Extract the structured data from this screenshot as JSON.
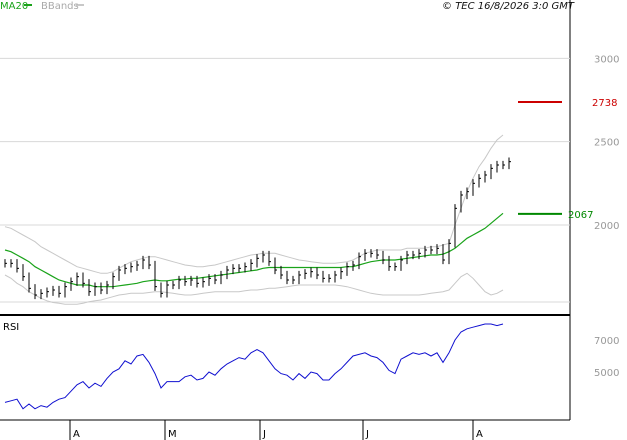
{
  "header": {
    "ma_label": "MA20",
    "bands_label": "BBands",
    "copyright": "© TEC 16/8/2026 3:0 GMT"
  },
  "colors": {
    "ma": "#1aa31a",
    "bands": "#c8c8c8",
    "price": "#000000",
    "rsi": "#1010d0",
    "resistance": "#cc0000",
    "support": "#008800",
    "grid": "#d8d8d8"
  },
  "chart_data": [
    {
      "type": "line",
      "subtype": "ohlc-bar",
      "ylim": [
        14.6,
        33.5
      ],
      "y_ticks": [
        {
          "value": 30.0,
          "label": "3000"
        },
        {
          "value": 25.0,
          "label": "2500"
        },
        {
          "value": 20.0,
          "label": "2000"
        }
      ],
      "x_labels": [
        "A",
        "M",
        "J",
        "J",
        "A"
      ],
      "levels": [
        {
          "name": "resistance",
          "value": 27.38,
          "label": "2738"
        },
        {
          "name": "support",
          "value": 20.67,
          "label": "2067"
        }
      ],
      "price": [
        17.7,
        17.7,
        17.4,
        16.9,
        16.2,
        15.8,
        15.9,
        16.0,
        16.1,
        15.9,
        16.3,
        16.6,
        16.9,
        16.5,
        16.0,
        16.3,
        16.1,
        16.4,
        16.9,
        17.3,
        17.4,
        17.5,
        17.6,
        17.9,
        17.6,
        16.3,
        15.9,
        16.4,
        16.4,
        16.7,
        16.6,
        16.7,
        16.5,
        16.6,
        16.8,
        16.7,
        17.0,
        17.3,
        17.4,
        17.4,
        17.5,
        17.7,
        18.0,
        18.2,
        17.8,
        17.3,
        17.0,
        16.7,
        16.7,
        17.0,
        17.1,
        17.2,
        17.0,
        16.8,
        16.8,
        17.0,
        17.2,
        17.5,
        17.6,
        18.1,
        18.3,
        18.3,
        18.2,
        17.9,
        17.5,
        17.5,
        17.9,
        18.2,
        18.2,
        18.3,
        18.5,
        18.5,
        18.6,
        17.9,
        18.9,
        21.0,
        21.8,
        22.0,
        22.5,
        22.8,
        23.0,
        23.4,
        23.6,
        23.6,
        23.8
      ],
      "ma20": [
        18.5,
        18.4,
        18.2,
        18.0,
        17.8,
        17.5,
        17.3,
        17.1,
        16.9,
        16.7,
        16.6,
        16.5,
        16.4,
        16.4,
        16.4,
        16.3,
        16.3,
        16.3,
        16.3,
        16.35,
        16.4,
        16.45,
        16.5,
        16.6,
        16.65,
        16.7,
        16.65,
        16.65,
        16.7,
        16.75,
        16.75,
        16.8,
        16.8,
        16.85,
        16.9,
        16.95,
        17.0,
        17.05,
        17.1,
        17.15,
        17.2,
        17.25,
        17.3,
        17.4,
        17.45,
        17.45,
        17.45,
        17.45,
        17.45,
        17.45,
        17.45,
        17.45,
        17.45,
        17.45,
        17.45,
        17.45,
        17.45,
        17.5,
        17.5,
        17.6,
        17.7,
        17.8,
        17.85,
        17.9,
        17.9,
        17.9,
        17.95,
        18.0,
        18.05,
        18.1,
        18.15,
        18.2,
        18.2,
        18.25,
        18.4,
        18.6,
        18.9,
        19.2,
        19.4,
        19.6,
        19.8,
        20.1,
        20.4,
        20.7
      ],
      "bb_upper": [
        19.9,
        19.8,
        19.6,
        19.4,
        19.2,
        19.0,
        18.7,
        18.5,
        18.3,
        18.1,
        17.9,
        17.7,
        17.5,
        17.4,
        17.3,
        17.2,
        17.1,
        17.1,
        17.2,
        17.4,
        17.6,
        17.8,
        17.9,
        18.0,
        18.1,
        18.1,
        18.0,
        17.9,
        17.8,
        17.7,
        17.6,
        17.55,
        17.5,
        17.5,
        17.55,
        17.6,
        17.7,
        17.8,
        17.9,
        18.0,
        18.1,
        18.2,
        18.25,
        18.3,
        18.3,
        18.3,
        18.2,
        18.1,
        18.0,
        17.9,
        17.85,
        17.8,
        17.75,
        17.7,
        17.7,
        17.7,
        17.75,
        17.8,
        17.9,
        18.1,
        18.3,
        18.4,
        18.5,
        18.5,
        18.5,
        18.5,
        18.5,
        18.6,
        18.6,
        18.6,
        18.6,
        18.7,
        18.7,
        18.8,
        18.9,
        20.0,
        21.0,
        22.0,
        22.8,
        23.5,
        24.0,
        24.6,
        25.1,
        25.4
      ],
      "bb_lower": [
        17.0,
        16.8,
        16.5,
        16.3,
        16.0,
        15.8,
        15.6,
        15.45,
        15.35,
        15.3,
        15.25,
        15.25,
        15.25,
        15.3,
        15.4,
        15.45,
        15.5,
        15.6,
        15.7,
        15.8,
        15.85,
        15.9,
        15.9,
        15.9,
        15.95,
        16.0,
        16.0,
        15.95,
        15.9,
        15.85,
        15.8,
        15.8,
        15.85,
        15.9,
        15.95,
        16.0,
        16.0,
        16.0,
        16.0,
        16.0,
        16.05,
        16.1,
        16.1,
        16.15,
        16.2,
        16.2,
        16.25,
        16.3,
        16.35,
        16.4,
        16.4,
        16.4,
        16.4,
        16.4,
        16.4,
        16.4,
        16.35,
        16.3,
        16.2,
        16.1,
        16.0,
        15.9,
        15.85,
        15.8,
        15.8,
        15.8,
        15.8,
        15.8,
        15.8,
        15.8,
        15.85,
        15.9,
        15.95,
        16.0,
        16.1,
        16.5,
        16.9,
        17.1,
        16.8,
        16.4,
        16.0,
        15.8,
        15.9,
        16.1
      ]
    },
    {
      "type": "line",
      "title": "RSI",
      "ylim": [
        20,
        85
      ],
      "y_ticks": [
        {
          "value": 70,
          "label": "7000"
        },
        {
          "value": 50,
          "label": "5000"
        }
      ],
      "values": [
        31,
        32,
        33,
        27,
        30,
        27,
        29,
        28,
        31,
        33,
        34,
        38,
        42,
        44,
        40,
        43,
        41,
        46,
        50,
        52,
        57,
        55,
        60,
        61,
        56,
        49,
        40,
        44,
        44,
        44,
        47,
        48,
        45,
        46,
        50,
        48,
        52,
        55,
        57,
        59,
        58,
        62,
        64,
        62,
        57,
        52,
        49,
        48,
        45,
        49,
        46,
        50,
        49,
        45,
        45,
        49,
        52,
        56,
        60,
        61,
        62,
        60,
        59,
        56,
        51,
        49,
        58,
        60,
        62,
        61,
        62,
        60,
        62,
        56,
        62,
        70,
        75,
        77,
        78,
        79,
        80,
        80,
        79,
        80
      ]
    }
  ]
}
